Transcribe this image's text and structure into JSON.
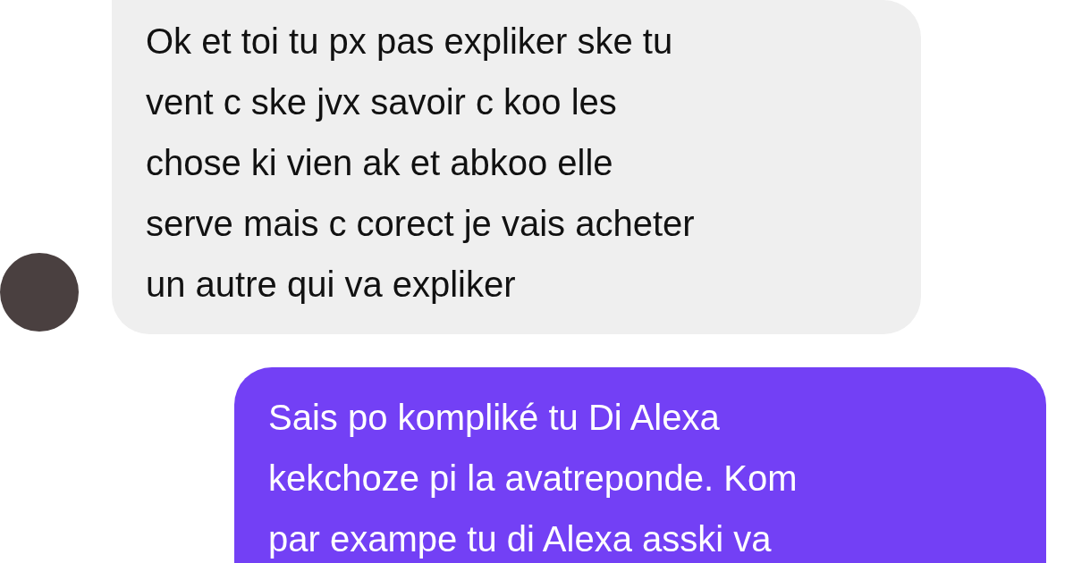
{
  "messages": [
    {
      "kind": "received",
      "text": "Ok et toi tu px pas expliker ske tu\nvent c ske jvx savoir c koo les\nchose ki vien ak et abkoo elle\nserve mais c corect je vais acheter\nun autre qui va expliker"
    },
    {
      "kind": "sent",
      "text": "Sais po kompliké tu Di Alexa\nkekchoze pi la avatreponde. Kom\npar exampe tu di Alexa asski va"
    }
  ]
}
